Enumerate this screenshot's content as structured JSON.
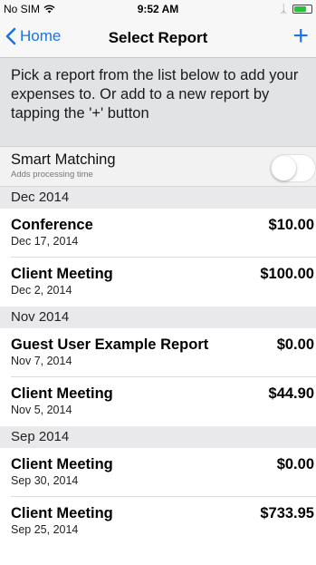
{
  "status_bar": {
    "carrier": "No SIM",
    "wifi_icon": "wifi-icon",
    "time": "9:52 AM",
    "bluetooth_icon": "bluetooth-icon",
    "battery_level": 0.75
  },
  "nav": {
    "back_label": "Home",
    "title": "Select Report",
    "add_label": "+"
  },
  "instructions": "Pick a report from the list below to add your expenses to.  Or add to a new report by tapping the '+' button",
  "smart_matching": {
    "title": "Smart Matching",
    "subtitle": "Adds processing time",
    "enabled": false
  },
  "sections": [
    {
      "header": "Dec 2014",
      "reports": [
        {
          "name": "Conference",
          "date": "Dec 17, 2014",
          "amount": "$10.00"
        },
        {
          "name": "Client Meeting",
          "date": "Dec 2, 2014",
          "amount": "$100.00"
        }
      ]
    },
    {
      "header": "Nov 2014",
      "reports": [
        {
          "name": "Guest User Example Report",
          "date": "Nov 7, 2014",
          "amount": "$0.00"
        },
        {
          "name": "Client Meeting",
          "date": "Nov 5, 2014",
          "amount": "$44.90"
        }
      ]
    },
    {
      "header": "Sep 2014",
      "reports": [
        {
          "name": "Client Meeting",
          "date": "Sep 30, 2014",
          "amount": "$0.00"
        },
        {
          "name": "Client Meeting",
          "date": "Sep 25, 2014",
          "amount": "$733.95"
        }
      ]
    }
  ],
  "colors": {
    "accent": "#1a73e8",
    "battery": "#25c23a"
  }
}
